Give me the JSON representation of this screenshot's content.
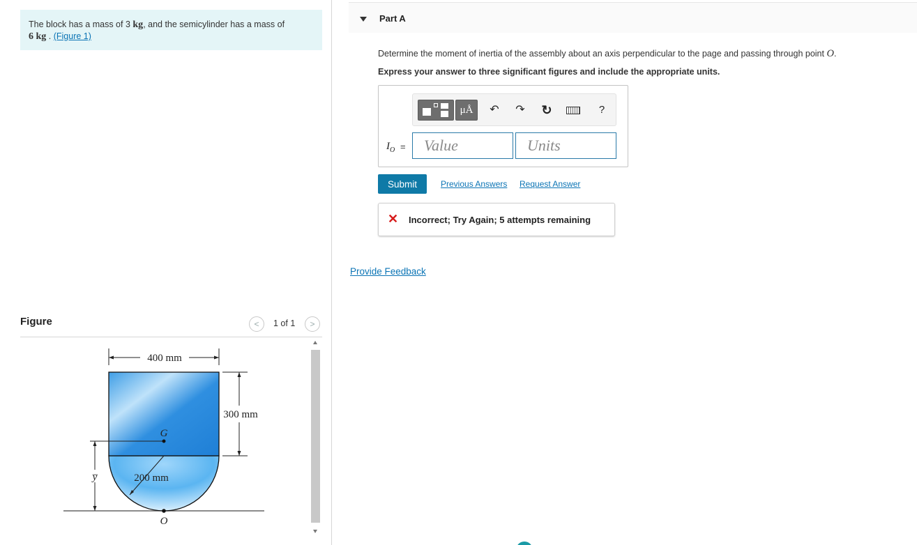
{
  "problem": {
    "text_before": "The block has a mass of 3",
    "unit1": "kg",
    "text_middle": ", and the semicylinder has a mass of",
    "value2": "6",
    "unit2": "kg",
    "dot": ".",
    "figure_link": "(Figure 1)"
  },
  "figure": {
    "title": "Figure",
    "pager_prev": "<",
    "pager_text": "1 of 1",
    "pager_next": ">",
    "labels": {
      "width": "400 mm",
      "height": "300 mm",
      "radius": "200 mm",
      "centroid": "G",
      "point": "O",
      "ybar": "y̅"
    }
  },
  "part": {
    "title": "Part A",
    "question_text": "Determine the moment of inertia of the assembly about an axis perpendicular to the page and passing through point",
    "question_point": "O",
    "question_end": ".",
    "instruction": "Express your answer to three significant figures and include the appropriate units."
  },
  "toolbar": {
    "units_symbol": "μÅ",
    "undo_icon": "↶",
    "redo_icon": "↷",
    "reset_icon": "↻",
    "help_label": "?"
  },
  "answer": {
    "variable": "I",
    "subscript": "O",
    "equals": "=",
    "value_placeholder": "Value",
    "units_placeholder": "Units"
  },
  "actions": {
    "submit": "Submit",
    "previous_answers": "Previous Answers",
    "request_answer": "Request Answer"
  },
  "feedback": {
    "icon": "✕",
    "message": "Incorrect; Try Again; 5 attempts remaining"
  },
  "footer": {
    "provide_feedback": "Provide Feedback"
  },
  "colors": {
    "accent": "#0f7aa7",
    "link": "#0b74b5",
    "error": "#d61a1a",
    "problem_bg": "#e4f5f7"
  }
}
